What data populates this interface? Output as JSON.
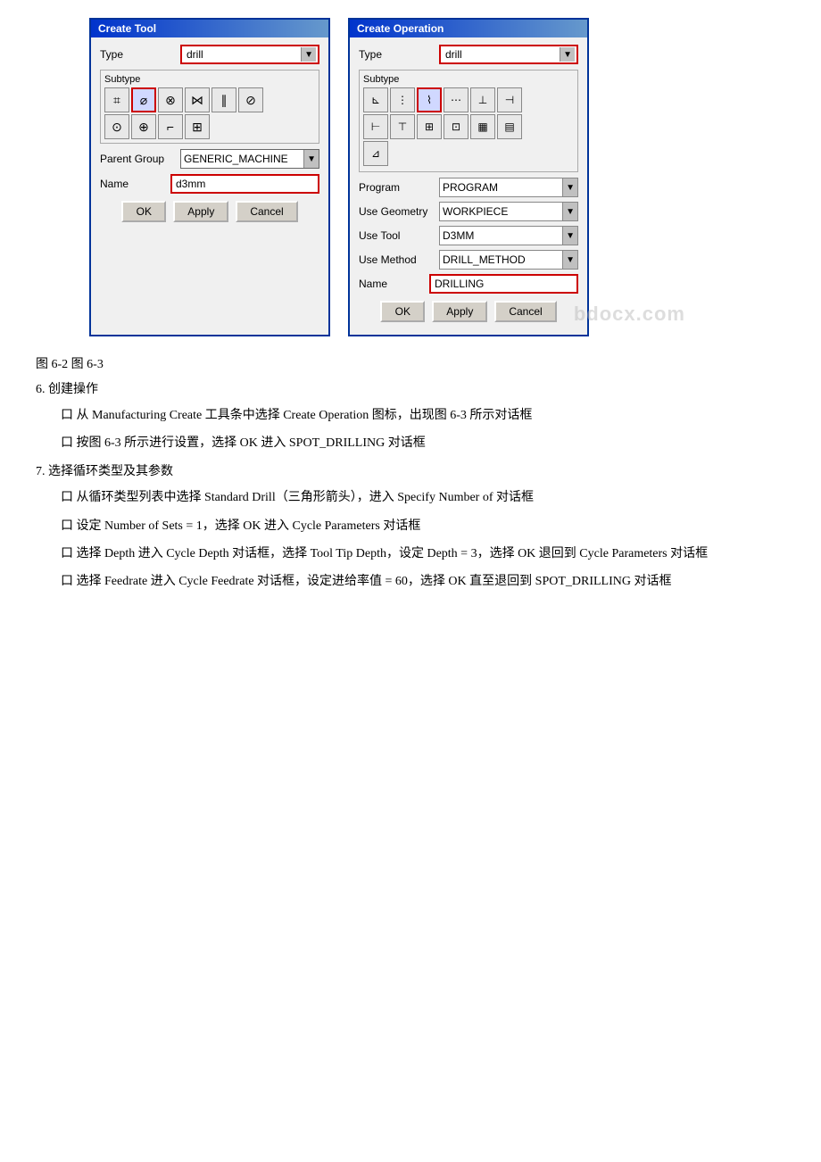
{
  "page": {
    "background": "#ffffff"
  },
  "create_tool_dialog": {
    "title": "Create Tool",
    "type_label": "Type",
    "type_value": "drill",
    "subtype_label": "Subtype",
    "subtype_icons": [
      "⌗",
      "⌀",
      "⊗",
      "⋈",
      "∥",
      "⊘",
      "⊙",
      "⊕",
      "⌐",
      "⊞"
    ],
    "parent_group_label": "Parent Group",
    "parent_group_value": "GENERIC_MACHINE",
    "name_label": "Name",
    "name_value": "d3mm",
    "btn_ok": "OK",
    "btn_apply": "Apply",
    "btn_cancel": "Cancel"
  },
  "create_operation_dialog": {
    "title": "Create Operation",
    "type_label": "Type",
    "type_value": "drill",
    "subtype_label": "Subtype",
    "subtype_icons_row1": [
      "⊾",
      "⋮",
      "⌇",
      "⋯",
      "⊥",
      "⊣"
    ],
    "subtype_icons_row2": [
      "⊣",
      "⊢",
      "⊤",
      "⊞",
      "⊡",
      "▦"
    ],
    "subtype_icons_row3": [
      "⊿"
    ],
    "program_label": "Program",
    "program_value": "PROGRAM",
    "use_geometry_label": "Use Geometry",
    "use_geometry_value": "WORKPIECE",
    "use_tool_label": "Use Tool",
    "use_tool_value": "D3MM",
    "use_method_label": "Use Method",
    "use_method_value": "DRILL_METHOD",
    "name_label": "Name",
    "name_value": "DRILLING",
    "btn_ok": "OK",
    "btn_apply": "Apply",
    "btn_cancel": "Cancel"
  },
  "watermark": "bdocx.com",
  "figure_label": "图 6-2 图 6-3",
  "section6_label": "6. 创建操作",
  "para1": "口 从 Manufacturing Create 工具条中选择 Create Operation 图标，出现图 6-3 所示对话框",
  "para2": "口 按图 6-3 所示进行设置，选择 OK 进入 SPOT_DRILLING 对话框",
  "section7_label": "7. 选择循环类型及其参数",
  "para3": "口 从循环类型列表中选择 Standard Drill（三角形箭头），进入 Specify Number of 对话框",
  "para4": "口 设定 Number of Sets = 1，选择 OK 进入 Cycle Parameters 对话框",
  "para5": "口 选择 Depth 进入 Cycle Depth 对话框，选择 Tool Tip Depth，设定 Depth = 3，选择 OK 退回到 Cycle Parameters 对话框",
  "para6": "口 选择 Feedrate 进入 Cycle Feedrate 对话框，设定进给率值 = 60，选择 OK 直至退回到 SPOT_DRILLING 对话框"
}
